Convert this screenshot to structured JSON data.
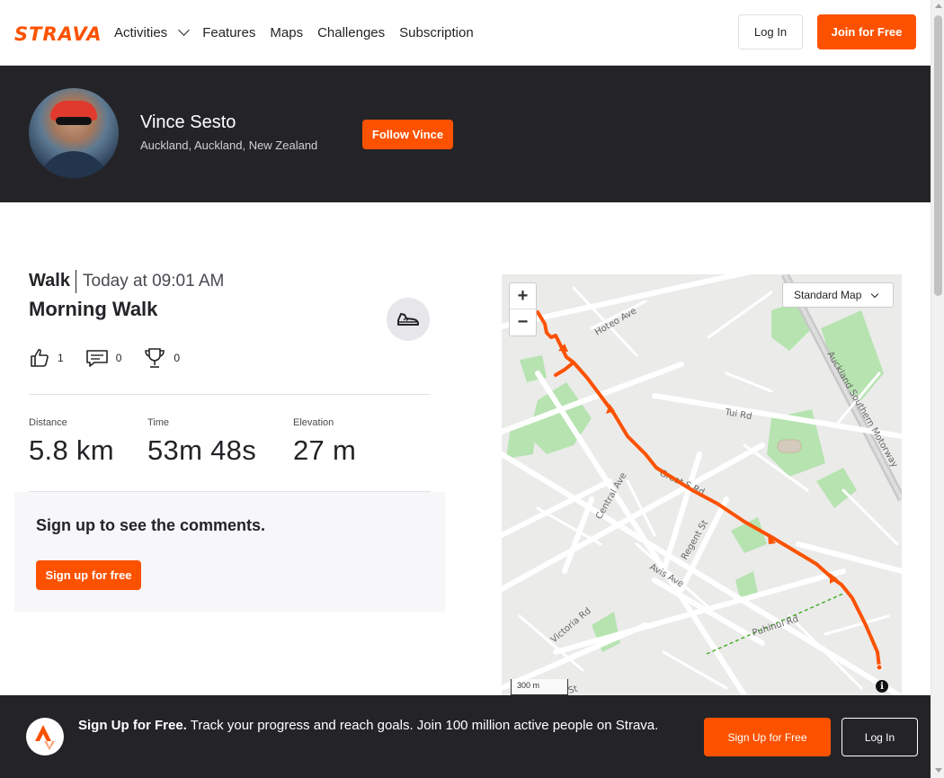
{
  "brand": {
    "name": "STRAVA",
    "accent": "#fc5200",
    "dark": "#242428"
  },
  "nav": {
    "items": [
      {
        "label": "Activities",
        "has_dropdown": true
      },
      {
        "label": "Features"
      },
      {
        "label": "Maps"
      },
      {
        "label": "Challenges"
      },
      {
        "label": "Subscription"
      }
    ],
    "login_label": "Log In",
    "join_label": "Join for Free"
  },
  "athlete": {
    "name": "Vince Sesto",
    "location": "Auckland, Auckland, New Zealand",
    "follow_label": "Follow Vince"
  },
  "activity": {
    "type": "Walk",
    "datetime": "Today at 09:01 AM",
    "title": "Morning Walk",
    "sport_icon": "shoe-icon",
    "kudos": "1",
    "comments": "0",
    "achievements": "0",
    "stats": [
      {
        "label": "Distance",
        "value": "5.8 km"
      },
      {
        "label": "Time",
        "value": "53m 48s"
      },
      {
        "label": "Elevation",
        "value": "27 m"
      }
    ]
  },
  "comments": {
    "title": "Sign up to see the comments.",
    "button": "Sign up for free"
  },
  "map": {
    "style_label": "Standard Map",
    "zoom_in": "+",
    "zoom_out": "−",
    "scale_label": "300 m",
    "info": "i",
    "street_labels": [
      "Hoteo Ave",
      "Auckland Southern Motorway",
      "Tui Rd",
      "Great S Rd",
      "Central Ave",
      "Regent St",
      "Avis Ave",
      "Puhinui Rd",
      "Victoria Rd",
      "St"
    ],
    "route_color": "#fc5200"
  },
  "banner": {
    "headline": "Sign Up for Free.",
    "text": " Track your progress and reach goals. Join 100 million active people on Strava.",
    "signup_label": "Sign Up for Free",
    "login_label": "Log In"
  }
}
